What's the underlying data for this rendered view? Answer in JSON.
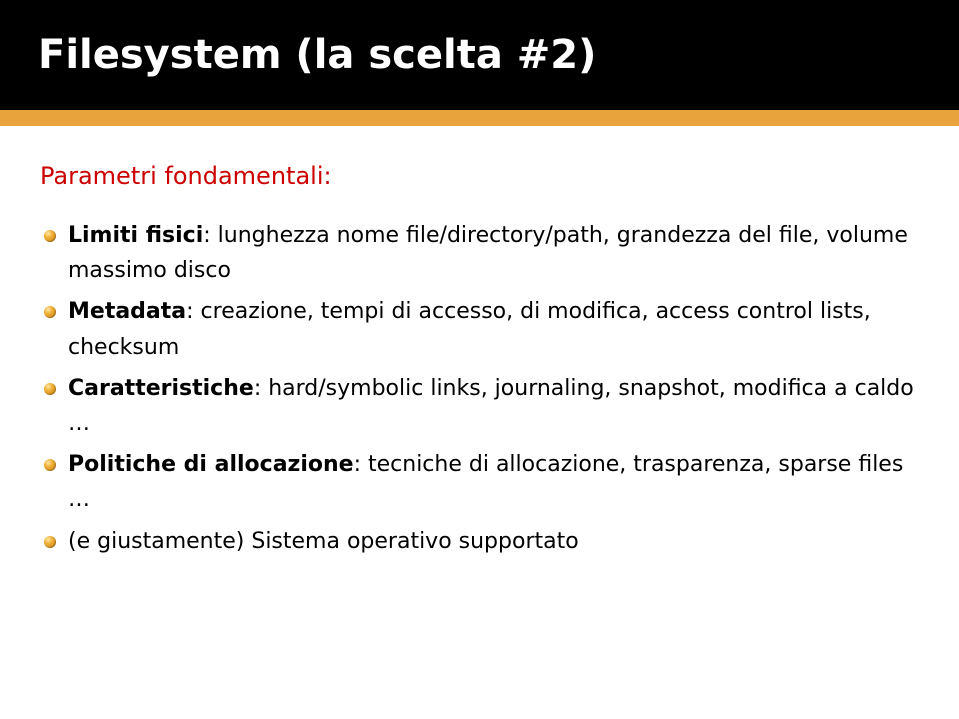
{
  "title": "Filesystem (la scelta #2)",
  "subtitle": "Parametri fondamentali:",
  "bullets": [
    {
      "term": "Limiti fisici",
      "rest": ": lunghezza nome file/directory/path, grandezza del file, volume massimo disco"
    },
    {
      "term": "Metadata",
      "rest": ": creazione, tempi di accesso, di modifica, access control lists, checksum"
    },
    {
      "term": "Caratteristiche",
      "rest": ": hard/symbolic links, journaling, snapshot, modifica a caldo …"
    },
    {
      "term": "Politiche di allocazione",
      "rest": ": tecniche di allocazione, trasparenza, sparse files …"
    },
    {
      "term": "",
      "rest": "(e giustamente) Sistema operativo supportato"
    }
  ]
}
